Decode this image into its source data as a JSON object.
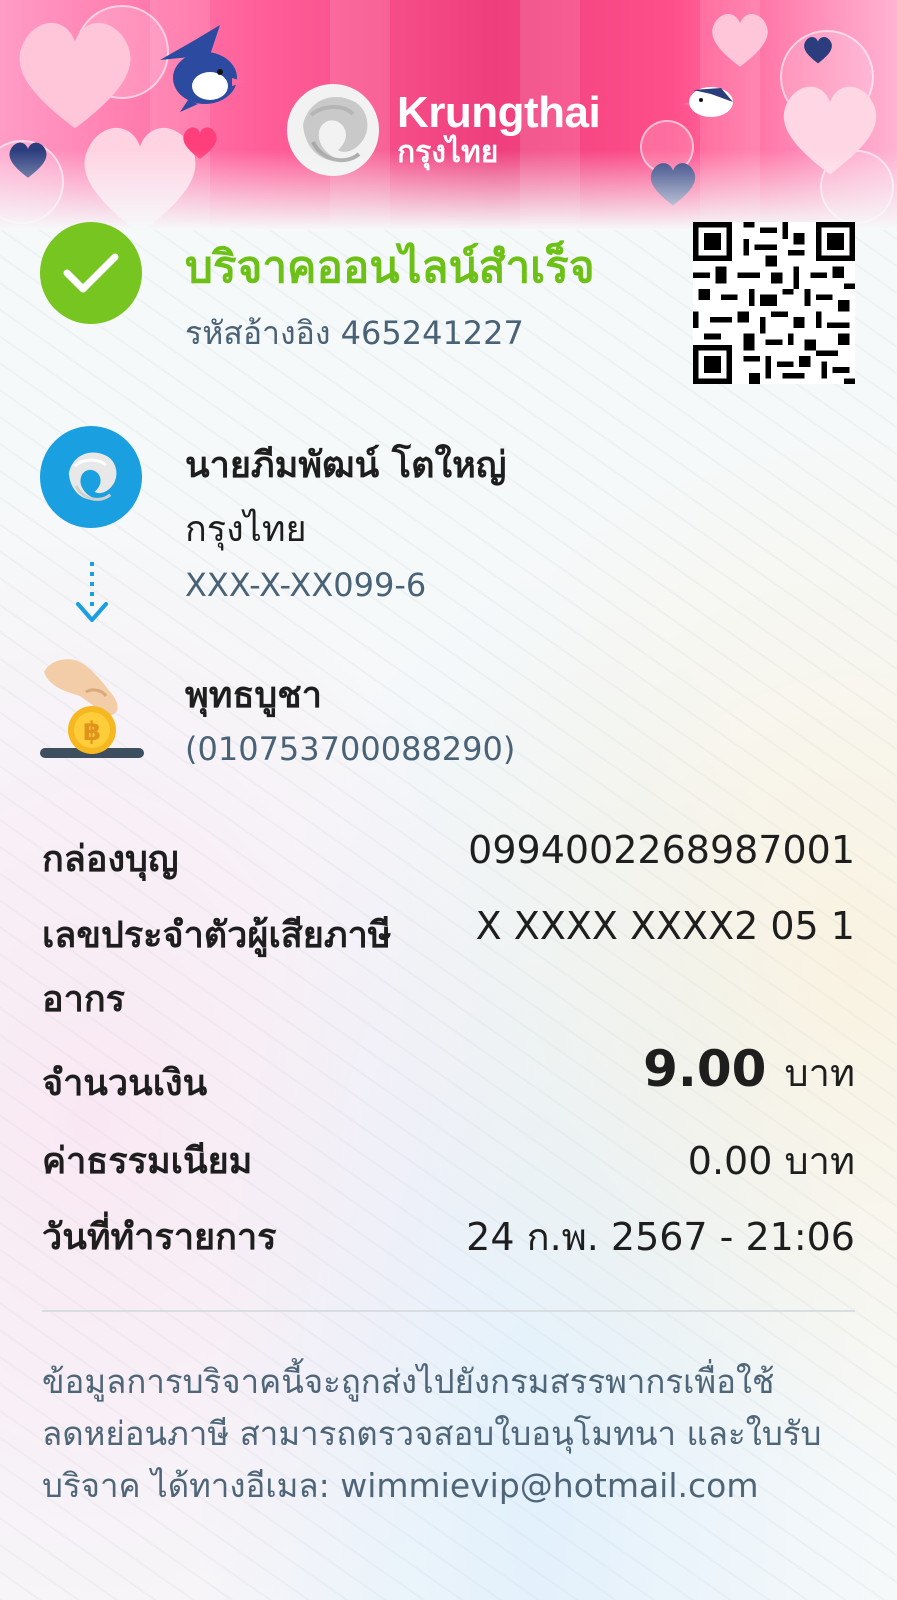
{
  "brand": {
    "name_en": "Krungthai",
    "name_th": "กรุงไทย"
  },
  "status": {
    "title": "บริจาคออนไลน์สำเร็จ",
    "ref_label": "รหัสอ้างอิง",
    "ref_number": "465241227",
    "color": "#6cc016"
  },
  "sender": {
    "name": "นายภีมพัฒน์ โตใหญ่",
    "bank": "กรุงไทย",
    "account": "XXX-X-XX099-6"
  },
  "receiver": {
    "name": "พุทธบูชา",
    "id": "(010753700088290)"
  },
  "details": {
    "box_label": "กล่องบุญ",
    "box_value": "0994002268987001",
    "tax_label_line1": "เลขประจำตัวผู้เสียภาษี",
    "tax_label_line2": "อากร",
    "tax_value": "X XXXX XXXX2 05 1",
    "amount_label": "จำนวนเงิน",
    "amount_value": "9.00",
    "amount_unit": "บาท",
    "fee_label": "ค่าธรรมเนียม",
    "fee_value": "0.00 บาท",
    "date_label": "วันที่ทำรายการ",
    "date_value": "24 ก.พ. 2567 - 21:06"
  },
  "note": {
    "line1": "ข้อมูลการบริจาคนี้จะถูกส่งไปยังกรมสรรพากรเพื่อใช้",
    "line2": "ลดหย่อนภาษี สามารถตรวจสอบใบอนุโมทนา และใบรับ",
    "line3": "บริจาค ได้ทางอีเมล: wimmievip@hotmail.com"
  },
  "icons": {
    "success": "check-icon",
    "bank": "krungthai-logo-icon",
    "transfer": "arrow-down-icon",
    "donate": "donation-coin-icon",
    "qr": "qr-code-icon"
  }
}
